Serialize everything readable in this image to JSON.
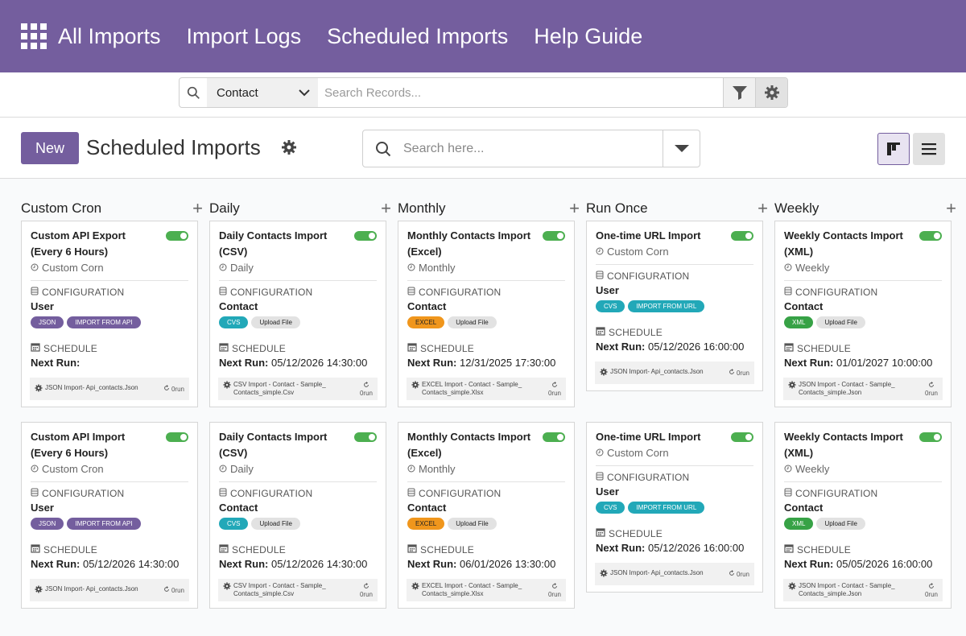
{
  "nav": {
    "items": [
      "All Imports",
      "Import Logs",
      "Scheduled Imports",
      "Help Guide"
    ]
  },
  "global_search": {
    "model": "Contact",
    "placeholder": "Search Records..."
  },
  "control_panel": {
    "new_label": "New",
    "title": "Scheduled Imports",
    "search_placeholder": "Search here..."
  },
  "colors": {
    "brand": "#745e9e",
    "toggle_on": "#4caf50",
    "json": "#745e9e",
    "csv": "#22a8b8",
    "excel": "#f0961c",
    "xml": "#37a246"
  },
  "columns": [
    {
      "title": "Custom Cron",
      "cards": [
        {
          "name": "Custom API Export (Every 6 Hours)",
          "freq": "Custom Corn",
          "model": "User",
          "badge1": "JSON",
          "badge2": "IMPORT FROM API",
          "next_label": "Next Run:",
          "next_value": "",
          "file": "JSON Import- Api_contacts.Json",
          "runs": "0run"
        },
        {
          "name": "Custom API Import (Every 6 Hours)",
          "freq": "Custom Cron",
          "model": "User",
          "badge1": "JSON",
          "badge2": "IMPORT FROM API",
          "next_label": "Next Run:",
          "next_value": "05/12/2026 14:30:00",
          "file": "JSON Import- Api_contacts.Json",
          "runs": "0run"
        }
      ]
    },
    {
      "title": "Daily",
      "cards": [
        {
          "name": "Daily Contacts Import (CSV)",
          "freq": "Daily",
          "model": "Contact",
          "badge1": "CVS",
          "badge2": "Upload File",
          "next_label": "Next Run:",
          "next_value": "05/12/2026 14:30:00",
          "file": "CSV Import - Contact - Sample_ Contacts_simple.Csv",
          "runs": "0run"
        },
        {
          "name": "Daily Contacts Import (CSV)",
          "freq": "Daily",
          "model": "Contact",
          "badge1": "CVS",
          "badge2": "Upload File",
          "next_label": "Next Run:",
          "next_value": "05/12/2026 14:30:00",
          "file": "CSV Import - Contact - Sample_ Contacts_simple.Csv",
          "runs": "0run"
        }
      ]
    },
    {
      "title": "Monthly",
      "cards": [
        {
          "name": "Monthly Contacts Import (Excel)",
          "freq": "Monthly",
          "model": "Contact",
          "badge1": "EXCEL",
          "badge2": "Upload File",
          "next_label": "Next Run:",
          "next_value": "12/31/2025 17:30:00",
          "file": "EXCEL Import - Contact - Sample_ Contacts_simple.Xlsx",
          "runs": "0run"
        },
        {
          "name": "Monthly Contacts Import (Excel)",
          "freq": "Monthly",
          "model": "Contact",
          "badge1": "EXCEL",
          "badge2": "Upload File",
          "next_label": "Next Run:",
          "next_value": "06/01/2026 13:30:00",
          "file": "EXCEL Import - Contact - Sample_ Contacts_simple.Xlsx",
          "runs": "0run"
        }
      ]
    },
    {
      "title": "Run Once",
      "cards": [
        {
          "name": "One-time URL Import",
          "freq": "Custom Corn",
          "model": "User",
          "badge1": "CVS",
          "badge2": "IMPORT FROM URL",
          "next_label": "Next Run:",
          "next_value": "05/12/2026 16:00:00",
          "file": "JSON Import- Api_contacts.Json",
          "runs": "0run"
        },
        {
          "name": "One-time URL Import",
          "freq": "Custom Corn",
          "model": "User",
          "badge1": "CVS",
          "badge2": "IMPORT FROM URL",
          "next_label": "Next Run:",
          "next_value": "05/12/2026 16:00:00",
          "file": "JSON Import- Api_contacts.Json",
          "runs": "0run"
        }
      ]
    },
    {
      "title": "Weekly",
      "cards": [
        {
          "name": "Weekly Contacts Import (XML)",
          "freq": "Weekly",
          "model": "Contact",
          "badge1": "XML",
          "badge2": "Upload File",
          "next_label": "Next Run:",
          "next_value": "01/01/2027 10:00:00",
          "file": "JSON Import - Contact - Sample_ Contacts_simple.Json",
          "runs": "0run"
        },
        {
          "name": "Weekly Contacts Import (XML)",
          "freq": "Weekly",
          "model": "Contact",
          "badge1": "XML",
          "badge2": "Upload File",
          "next_label": "Next Run:",
          "next_value": "05/05/2026 16:00:00",
          "file": "JSON Import - Contact - Sample_ Contacts_simple.Json",
          "runs": "0run"
        }
      ]
    }
  ],
  "labels": {
    "configuration": "CONFIGURATION",
    "schedule": "SCHEDULE"
  }
}
